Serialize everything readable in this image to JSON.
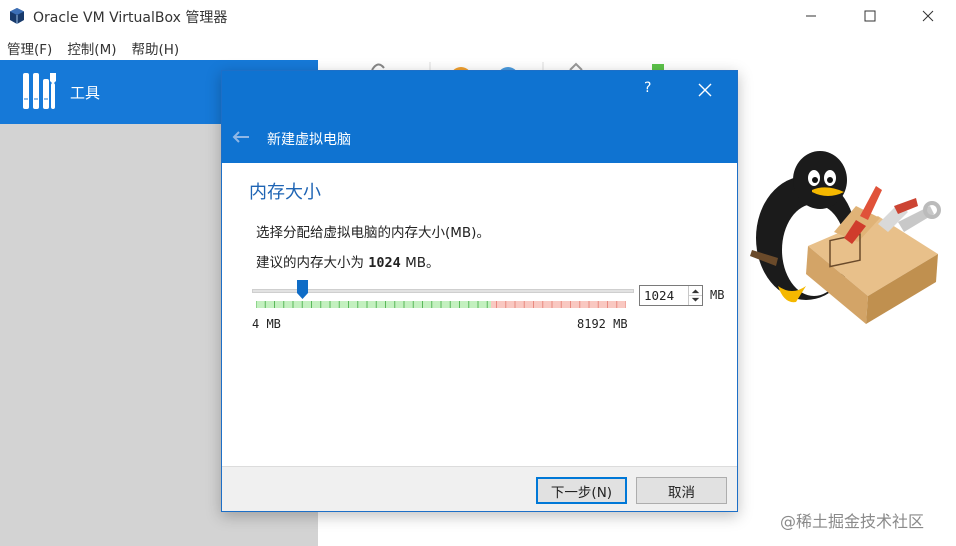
{
  "window": {
    "title": "Oracle VM VirtualBox 管理器",
    "icon": "virtualbox-logo-icon"
  },
  "menu": [
    {
      "label": "管理(F)"
    },
    {
      "label": "控制(M)"
    },
    {
      "label": "帮助(H)"
    }
  ],
  "sidebar": {
    "tools_label": "工具"
  },
  "dialog": {
    "help": "?",
    "heading": "新建虚拟电脑",
    "section_title": "内存大小",
    "description": "选择分配给虚拟电脑的内存大小(MB)。",
    "recommend_prefix": "建议的内存大小为 ",
    "recommend_value": "1024",
    "recommend_suffix": " MB。",
    "slider": {
      "min_label": "4 MB",
      "max_label": "8192 MB",
      "min": 4,
      "max": 8192,
      "value": 1024,
      "green_until": 5200
    },
    "memory_value": "1024",
    "memory_unit": "MB",
    "buttons": {
      "next": "下一步(N)",
      "cancel": "取消"
    }
  },
  "watermark": "@稀土掘金技术社区",
  "colors": {
    "accent": "#0f73d1",
    "sidebar_selected": "#1679d8",
    "sidebar_bg": "#d3d3d3",
    "title_text": "#1e64b4"
  }
}
